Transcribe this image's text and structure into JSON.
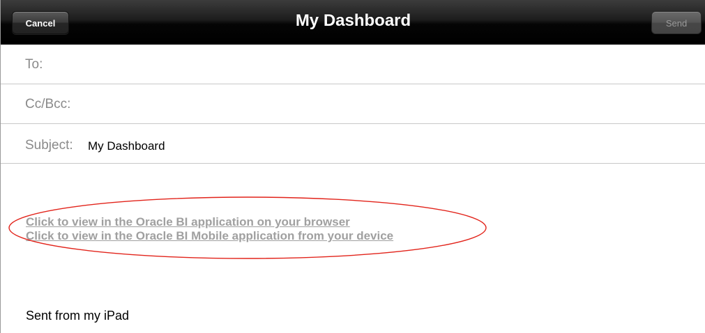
{
  "navbar": {
    "title": "My Dashboard",
    "cancel_label": "Cancel",
    "send_label": "Send"
  },
  "fields": {
    "to_label": "To:",
    "cc_label": "Cc/Bcc:",
    "subject_label": "Subject:",
    "subject_value": "My Dashboard"
  },
  "body": {
    "links": [
      "Click to view in the Oracle BI application on your browser",
      "Click to view in the Oracle BI Mobile application from your device"
    ],
    "signature": "Sent from my iPad"
  },
  "colors": {
    "annotation": "#e2231a",
    "link": "#a0a0a0",
    "field_label": "#8a8a8a"
  }
}
